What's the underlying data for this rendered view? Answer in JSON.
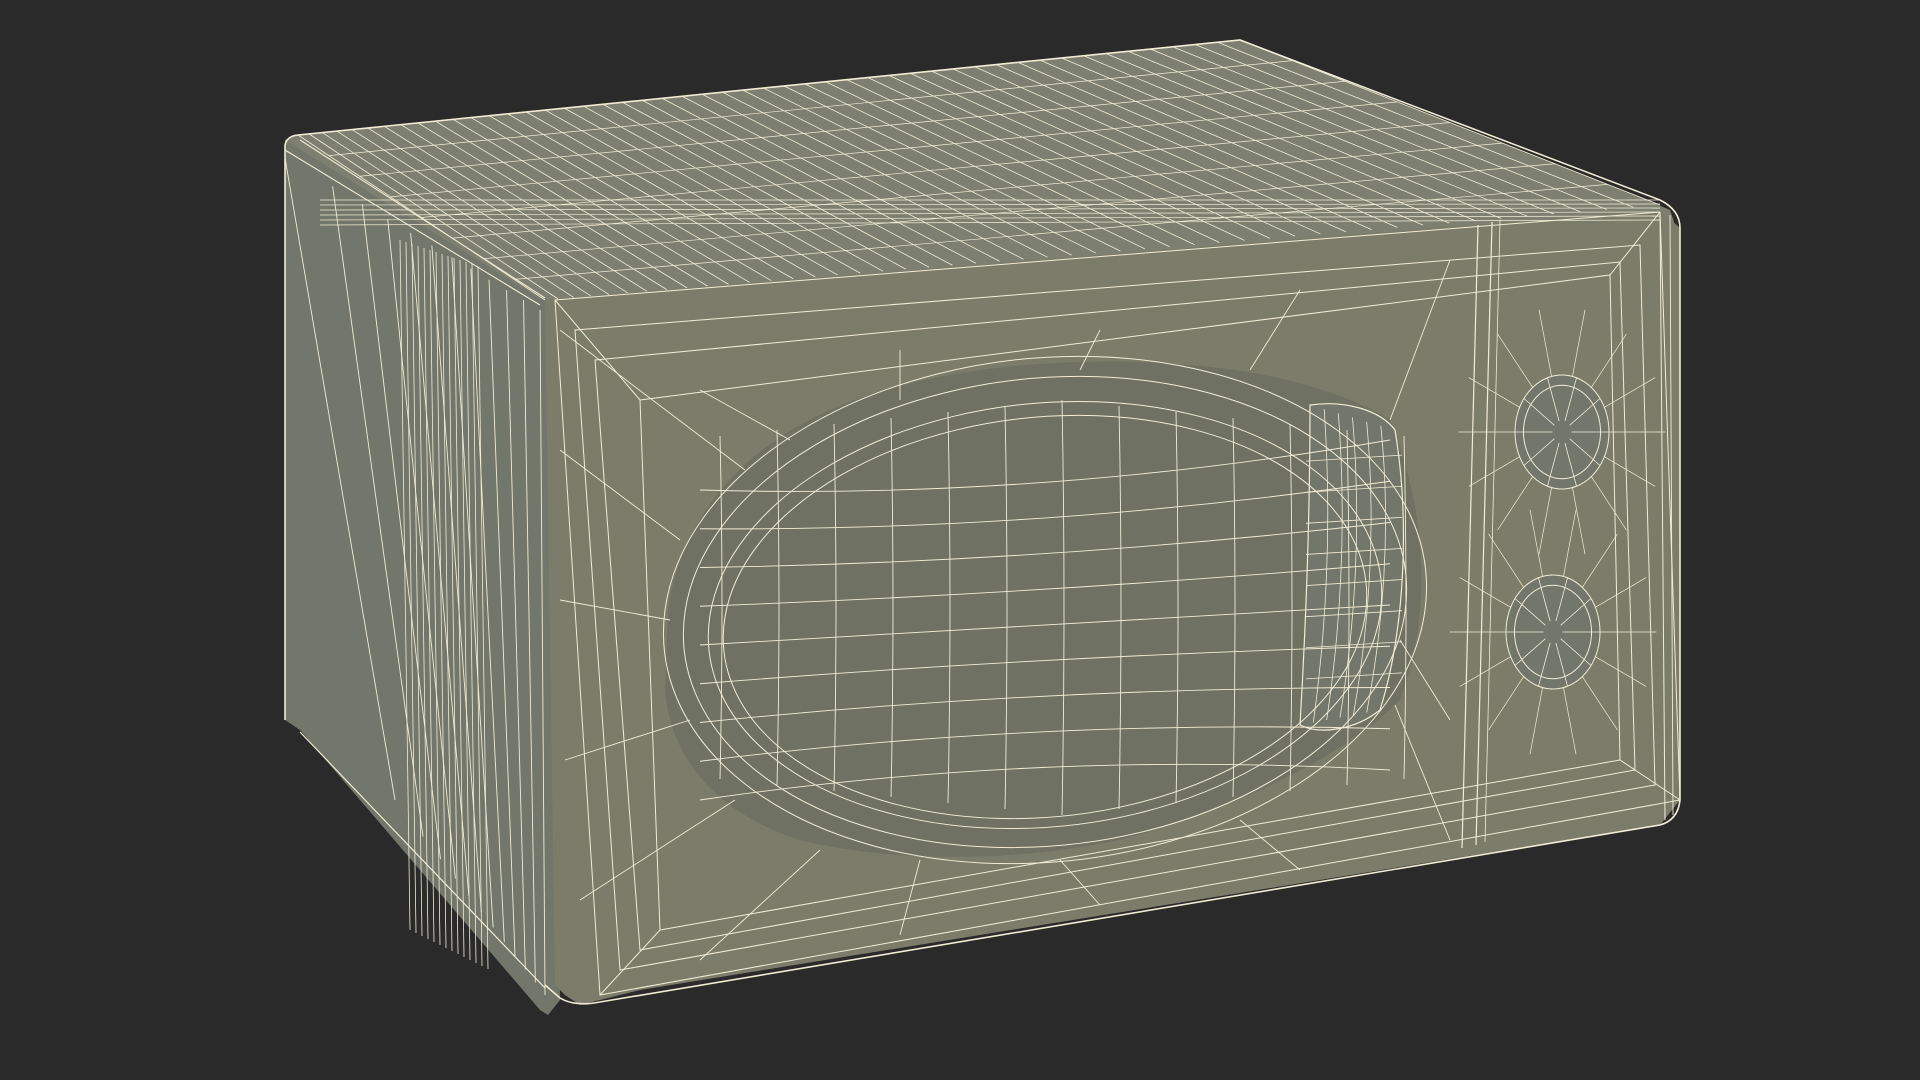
{
  "scene": {
    "subject": "microwave-oven-wireframe",
    "render_mode": "wireframe-on-shaded"
  },
  "colors": {
    "background": "#2a2a2a",
    "surface": "#7b7d6a",
    "surface_side": "#73766a",
    "surface_top": "#7d8070",
    "surface_recess": "#6f7263",
    "wire": "#f1ecd6"
  },
  "icons": {
    "door_window": "oval-window-shape",
    "door_handle": "handle-shape",
    "knob_timer": "dial-knob-shape",
    "knob_power": "dial-knob-shape"
  }
}
